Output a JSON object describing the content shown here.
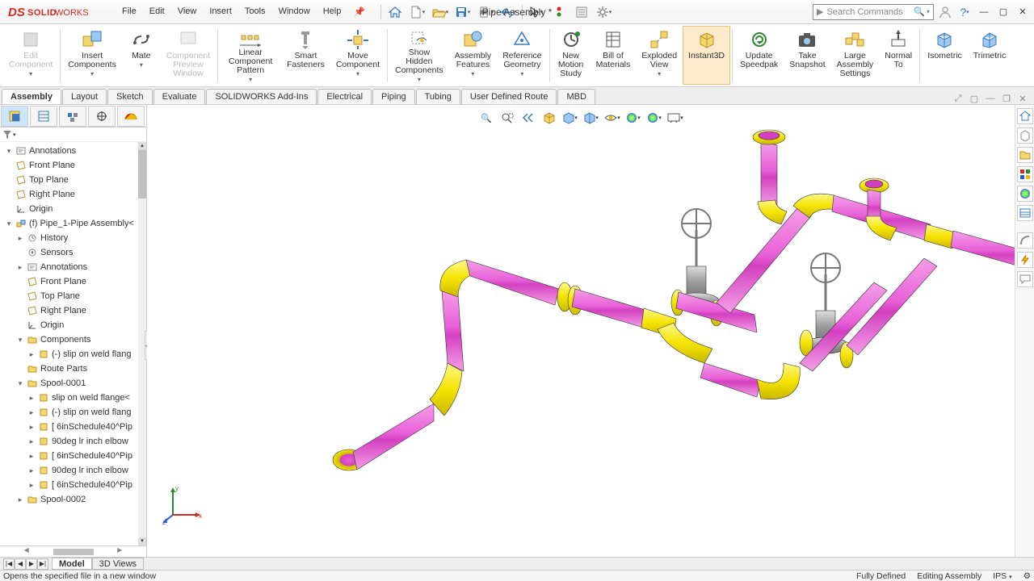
{
  "app": {
    "name": "SOLIDWORKS",
    "doc_title": "Pipe Assembly *"
  },
  "menu": [
    "File",
    "Edit",
    "View",
    "Insert",
    "Tools",
    "Window",
    "Help"
  ],
  "search": {
    "placeholder": "Search Commands"
  },
  "ribbon": [
    {
      "id": "edit-component",
      "label": "Edit\nComponent",
      "disabled": true,
      "dd": true
    },
    {
      "id": "insert-components",
      "label": "Insert\nComponents",
      "dd": true
    },
    {
      "id": "mate",
      "label": "Mate",
      "dd": true
    },
    {
      "id": "component-preview-window",
      "label": "Component\nPreview\nWindow",
      "disabled": true
    },
    {
      "id": "linear-component-pattern",
      "label": "Linear Component\nPattern",
      "dd": true
    },
    {
      "id": "smart-fasteners",
      "label": "Smart\nFasteners"
    },
    {
      "id": "move-component",
      "label": "Move\nComponent",
      "dd": true
    },
    {
      "id": "show-hidden-components",
      "label": "Show\nHidden\nComponents",
      "dd": true
    },
    {
      "id": "assembly-features",
      "label": "Assembly\nFeatures",
      "dd": true
    },
    {
      "id": "reference-geometry",
      "label": "Reference\nGeometry",
      "dd": true
    },
    {
      "id": "new-motion-study",
      "label": "New\nMotion\nStudy"
    },
    {
      "id": "bill-of-materials",
      "label": "Bill of\nMaterials"
    },
    {
      "id": "exploded-view",
      "label": "Exploded\nView",
      "dd": true
    },
    {
      "id": "instant3d",
      "label": "Instant3D",
      "active": true
    },
    {
      "id": "update-speedpak",
      "label": "Update\nSpeedpak"
    },
    {
      "id": "take-snapshot",
      "label": "Take\nSnapshot"
    },
    {
      "id": "large-assembly-settings",
      "label": "Large\nAssembly\nSettings"
    },
    {
      "id": "normal-to",
      "label": "Normal\nTo"
    },
    {
      "id": "isometric",
      "label": "Isometric"
    },
    {
      "id": "trimetric",
      "label": "Trimetric"
    }
  ],
  "tabs": [
    "Assembly",
    "Layout",
    "Sketch",
    "Evaluate",
    "SOLIDWORKS Add-Ins",
    "Electrical",
    "Piping",
    "Tubing",
    "User Defined Route",
    "MBD"
  ],
  "active_tab": "Assembly",
  "tree": [
    {
      "d": 0,
      "exp": "▾",
      "ico": "ann",
      "label": "Annotations"
    },
    {
      "d": 0,
      "exp": "",
      "ico": "plane",
      "label": "Front Plane"
    },
    {
      "d": 0,
      "exp": "",
      "ico": "plane",
      "label": "Top Plane"
    },
    {
      "d": 0,
      "exp": "",
      "ico": "plane",
      "label": "Right Plane"
    },
    {
      "d": 0,
      "exp": "",
      "ico": "origin",
      "label": "Origin"
    },
    {
      "d": 0,
      "exp": "▾",
      "ico": "asm",
      "label": "(f) Pipe_1-Pipe Assembly<"
    },
    {
      "d": 1,
      "exp": "▸",
      "ico": "hist",
      "label": "History"
    },
    {
      "d": 1,
      "exp": "",
      "ico": "sensor",
      "label": "Sensors"
    },
    {
      "d": 1,
      "exp": "▸",
      "ico": "ann",
      "label": "Annotations"
    },
    {
      "d": 1,
      "exp": "",
      "ico": "plane",
      "label": "Front Plane"
    },
    {
      "d": 1,
      "exp": "",
      "ico": "plane",
      "label": "Top Plane"
    },
    {
      "d": 1,
      "exp": "",
      "ico": "plane",
      "label": "Right Plane"
    },
    {
      "d": 1,
      "exp": "",
      "ico": "origin",
      "label": "Origin"
    },
    {
      "d": 1,
      "exp": "▾",
      "ico": "folder",
      "label": "Components"
    },
    {
      "d": 2,
      "exp": "▸",
      "ico": "part",
      "label": "(-) slip on weld flang"
    },
    {
      "d": 1,
      "exp": "",
      "ico": "folder",
      "label": "Route Parts"
    },
    {
      "d": 1,
      "exp": "▾",
      "ico": "folder",
      "label": "Spool-0001"
    },
    {
      "d": 2,
      "exp": "▸",
      "ico": "part",
      "label": "slip on weld flange<"
    },
    {
      "d": 2,
      "exp": "▸",
      "ico": "part",
      "label": "(-) slip on weld flang"
    },
    {
      "d": 2,
      "exp": "▸",
      "ico": "part",
      "label": "[ 6inSchedule40^Pip"
    },
    {
      "d": 2,
      "exp": "▸",
      "ico": "part",
      "label": "90deg lr inch elbow"
    },
    {
      "d": 2,
      "exp": "▸",
      "ico": "part",
      "label": "[ 6inSchedule40^Pip"
    },
    {
      "d": 2,
      "exp": "▸",
      "ico": "part",
      "label": "90deg lr inch elbow"
    },
    {
      "d": 2,
      "exp": "▸",
      "ico": "part",
      "label": "[ 6inSchedule40^Pip"
    },
    {
      "d": 1,
      "exp": "▸",
      "ico": "folder",
      "label": "Spool-0002"
    }
  ],
  "bottom_tabs": [
    "Model",
    "3D Views"
  ],
  "active_bottom_tab": "Model",
  "status": {
    "hint": "Opens the specified file in a new window",
    "state": "Fully Defined",
    "mode": "Editing Assembly",
    "units": "IPS"
  },
  "colors": {
    "pipe": "#e85fd8",
    "fitting": "#f5e400",
    "steel": "#9a9a9a"
  }
}
